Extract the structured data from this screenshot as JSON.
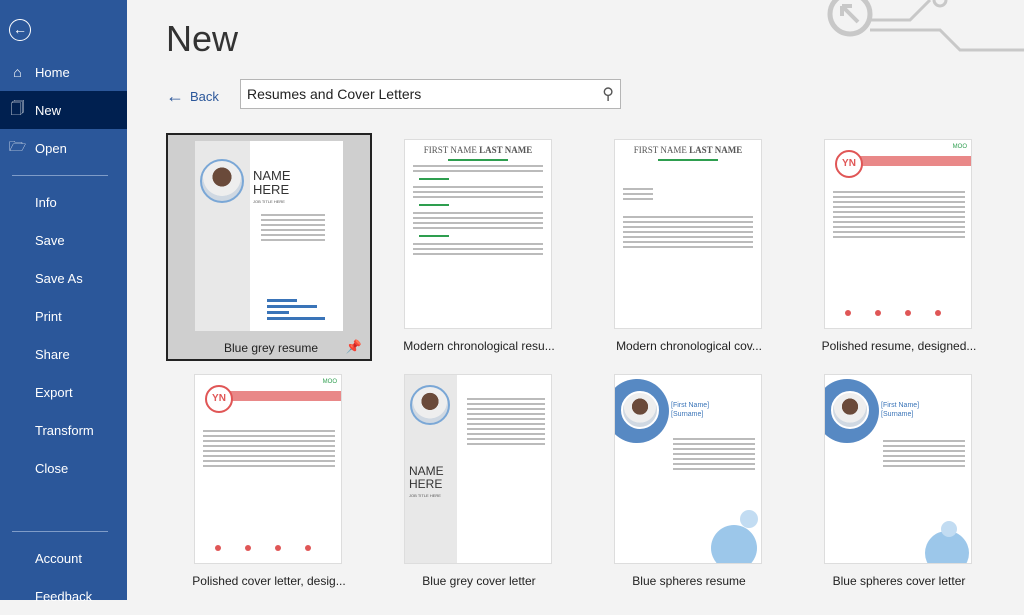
{
  "sidebar": {
    "items": [
      {
        "label": "Home",
        "icon": "home-icon"
      },
      {
        "label": "New",
        "icon": "new-document-icon",
        "selected": true
      },
      {
        "label": "Open",
        "icon": "folder-open-icon"
      },
      {
        "label": "Info"
      },
      {
        "label": "Save"
      },
      {
        "label": "Save As"
      },
      {
        "label": "Print"
      },
      {
        "label": "Share"
      },
      {
        "label": "Export"
      },
      {
        "label": "Transform"
      },
      {
        "label": "Close"
      },
      {
        "label": "Account"
      },
      {
        "label": "Feedback"
      }
    ],
    "color": "#2b579a",
    "selected_color": "#002050"
  },
  "header": {
    "title": "New",
    "back_label": "Back"
  },
  "search": {
    "value": "Resumes and Cover Letters"
  },
  "templates": [
    {
      "label": "Blue grey resume",
      "selected": true,
      "name": "NAME",
      "name2": "HERE",
      "sub": "JOB TITLE HERE"
    },
    {
      "label": "Modern chronological resu...",
      "heading1": "FIRST NAME ",
      "heading2": "LAST NAME"
    },
    {
      "label": "Modern chronological cov...",
      "heading1": "FIRST NAME ",
      "heading2": "LAST NAME"
    },
    {
      "label": "Polished resume, designed...",
      "initials": "YN",
      "badge": "MOO"
    },
    {
      "label": "Polished cover letter, desig...",
      "initials": "YN",
      "badge": "MOO"
    },
    {
      "label": "Blue grey cover letter",
      "name": "NAME",
      "name2": "HERE",
      "sub": "JOB TITLE HERE"
    },
    {
      "label": "Blue spheres resume",
      "field1": "[First Name]",
      "field2": "[Surname]"
    },
    {
      "label": "Blue spheres cover letter",
      "field1": "[First Name]",
      "field2": "[Surname]"
    }
  ]
}
